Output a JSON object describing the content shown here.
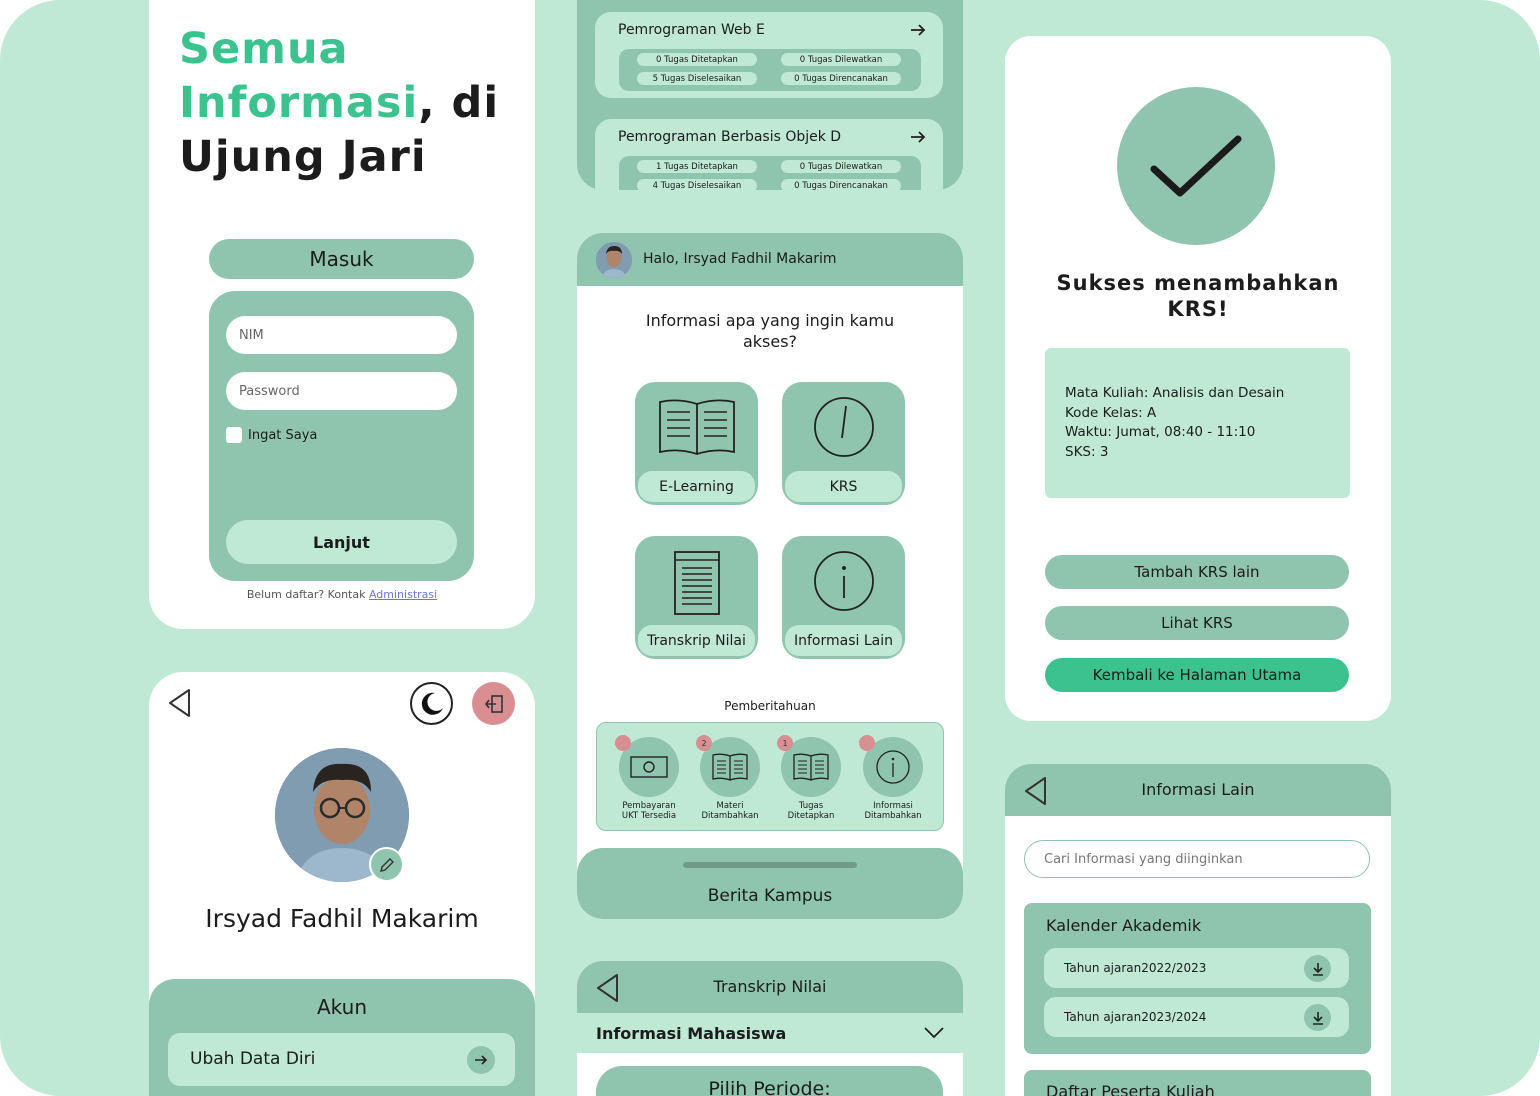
{
  "colors": {
    "background": "#bfe9d5",
    "sage": "#8fc4ae",
    "accent": "#3cc28f",
    "danger": "#d98e92"
  },
  "login": {
    "headline": {
      "line1": "Semua",
      "line2_accent": "Informasi",
      "line2_rest": ", di",
      "line3": "Ujung Jari"
    },
    "title": "Masuk",
    "nim_placeholder": "NIM",
    "password_placeholder": "Password",
    "remember_label": "Ingat Saya",
    "submit_label": "Lanjut",
    "footer_text": "Belum daftar? Kontak ",
    "footer_link": "Administrasi"
  },
  "profile": {
    "name": "Irsyad Fadhil Makarim",
    "section_title": "Akun",
    "menu_item": "Ubah Data Diri",
    "icons": [
      "back-arrow-icon",
      "moon-icon",
      "logout-icon",
      "pencil-icon"
    ]
  },
  "elearning_courses": [
    {
      "title": "Pemrograman Web E",
      "tags": [
        "0 Tugas Ditetapkan",
        "0 Tugas Dilewatkan",
        "5 Tugas Diselesaikan",
        "0 Tugas Direncanakan"
      ]
    },
    {
      "title": "Pemrograman Berbasis Objek D",
      "tags": [
        "1 Tugas Ditetapkan",
        "0 Tugas Dilewatkan",
        "4 Tugas Diselesaikan",
        "0 Tugas Direncanakan"
      ]
    }
  ],
  "home": {
    "greeting": "Halo, Irsyad Fadhil Makarim",
    "question": "Informasi apa yang ingin kamu akses?",
    "menu": [
      {
        "label": "E-Learning",
        "icon": "open-book-icon"
      },
      {
        "label": "KRS",
        "icon": "clock-icon"
      },
      {
        "label": "Transkrip Nilai",
        "icon": "document-icon"
      },
      {
        "label": "Informasi Lain",
        "icon": "info-icon"
      }
    ],
    "notifications_title": "Pemberitahuan",
    "notifications": [
      {
        "label": "Pembayaran UKT Tersedia",
        "badge": "",
        "icon": "money-icon"
      },
      {
        "label": "Materi Ditambahkan",
        "badge": "2",
        "icon": "book-icon"
      },
      {
        "label": "Tugas Ditetapkan",
        "badge": "1",
        "icon": "book-icon"
      },
      {
        "label": "Informasi Ditambahkan",
        "badge": "",
        "icon": "info-icon"
      }
    ],
    "news_title": "Berita Kampus"
  },
  "transcript": {
    "title": "Transkrip Nilai",
    "section": "Informasi Mahasiswa",
    "period_label": "Pilih Periode:"
  },
  "krs_success": {
    "title": "Sukses menambahkan KRS!",
    "details": [
      "Mata Kuliah: Analisis dan Desain",
      "Kode Kelas: A",
      "Waktu: Jumat, 08:40 - 11:10",
      "SKS: 3"
    ],
    "buttons": [
      "Tambah KRS lain",
      "Lihat KRS",
      "Kembali ke Halaman Utama"
    ]
  },
  "info_lain": {
    "title": "Informasi Lain",
    "search_placeholder": "Cari Informasi yang diinginkan",
    "calendar_title": "Kalender Akademik",
    "years": [
      {
        "prefix": "Tahun ajaran ",
        "year": "2022/2023"
      },
      {
        "prefix": "Tahun ajaran ",
        "year": "2023/2024"
      }
    ],
    "participants_title": "Daftar Peserta Kuliah"
  }
}
